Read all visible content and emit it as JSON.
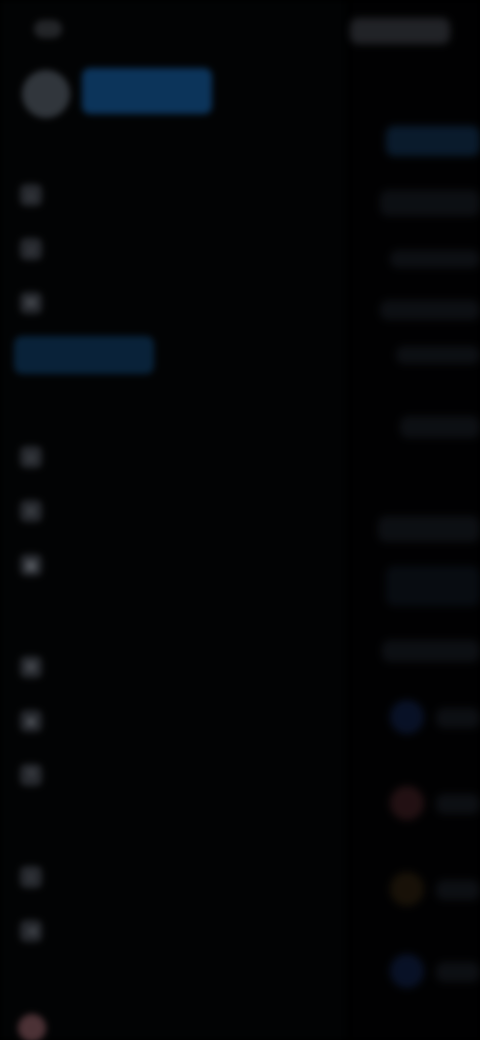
{
  "colors": {
    "background": "#000000",
    "accent": "#4aa3ff",
    "active_row": "#0b2944"
  },
  "profile": {
    "name": ""
  },
  "sections": {
    "primary": [
      {
        "label": "",
        "icon": "home-icon"
      },
      {
        "label": "",
        "icon": "bell-icon"
      },
      {
        "label": "",
        "icon": "message-icon"
      },
      {
        "label": "",
        "icon": "bookmark-icon",
        "active": true
      }
    ],
    "secondary_caption": "",
    "secondary": [
      {
        "label": "",
        "icon": "users-icon"
      },
      {
        "label": "",
        "icon": "list-icon"
      },
      {
        "label": "",
        "icon": "calendar-icon"
      }
    ],
    "tertiary_caption": "",
    "tertiary": [
      {
        "label": "",
        "icon": "settings-icon"
      },
      {
        "label": "",
        "icon": "shield-icon"
      },
      {
        "label": "",
        "icon": "help-icon"
      }
    ],
    "quaternary_caption": "",
    "quaternary": [
      {
        "label": "",
        "icon": "info-icon"
      },
      {
        "label": "",
        "icon": "logout-icon"
      }
    ]
  },
  "bottom_user": {
    "label": ""
  }
}
